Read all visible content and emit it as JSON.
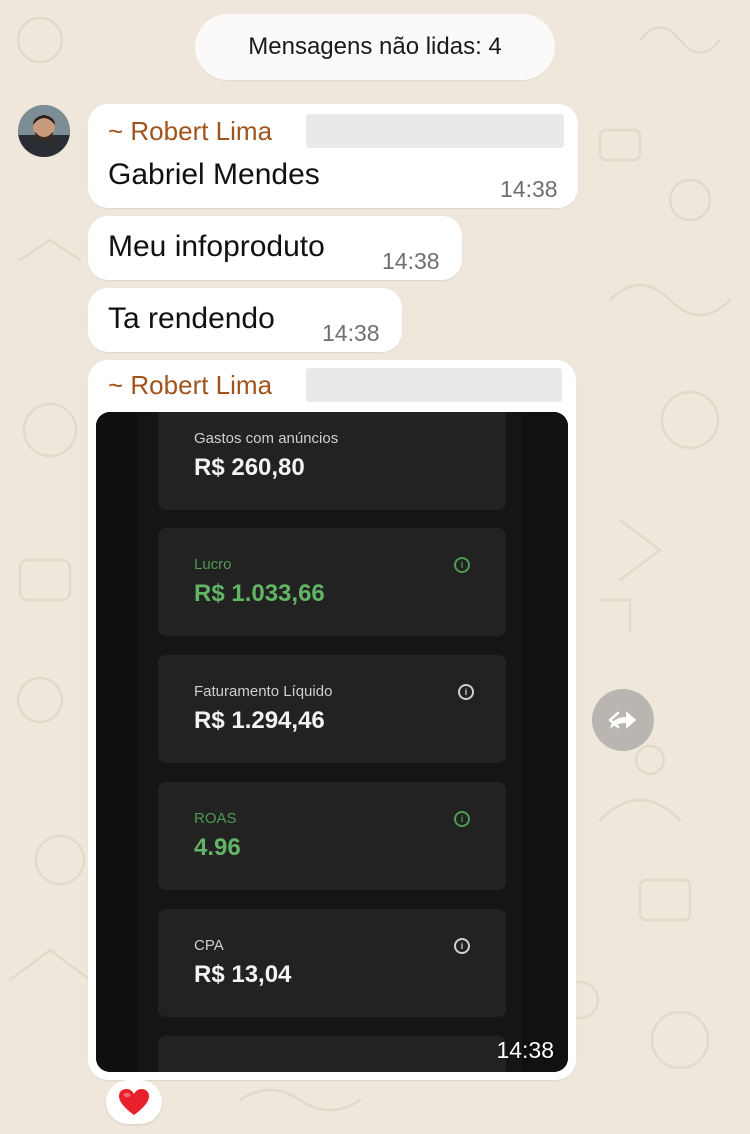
{
  "unread_banner": "Mensagens não lidas: 4",
  "messages": [
    {
      "sender": "~ Robert Lima",
      "text": "Gabriel Mendes",
      "time": "14:38"
    },
    {
      "text": "Meu infoproduto",
      "time": "14:38"
    },
    {
      "text": "Ta rendendo",
      "time": "14:38"
    }
  ],
  "image_message": {
    "sender": "~ Robert Lima",
    "time": "14:38",
    "cards": [
      {
        "label": "Gastos com anúncios",
        "value": "R$ 260,80",
        "highlight": false,
        "info_icon": false
      },
      {
        "label": "Lucro",
        "value": "R$ 1.033,66",
        "highlight": true,
        "info_icon": true
      },
      {
        "label": "Faturamento Líquido",
        "value": "R$ 1.294,46",
        "highlight": false,
        "info_icon": true
      },
      {
        "label": "ROAS",
        "value": "4.96",
        "highlight": true,
        "info_icon": true
      },
      {
        "label": "CPA",
        "value": "R$ 13,04",
        "highlight": false,
        "info_icon": true
      }
    ]
  },
  "reaction": {
    "emoji": "heart-icon"
  },
  "colors": {
    "background": "#efe7db",
    "bubble": "#ffffff",
    "sender_name": "#a0531c",
    "positive_metric": "#61b565",
    "card": "#222222"
  }
}
